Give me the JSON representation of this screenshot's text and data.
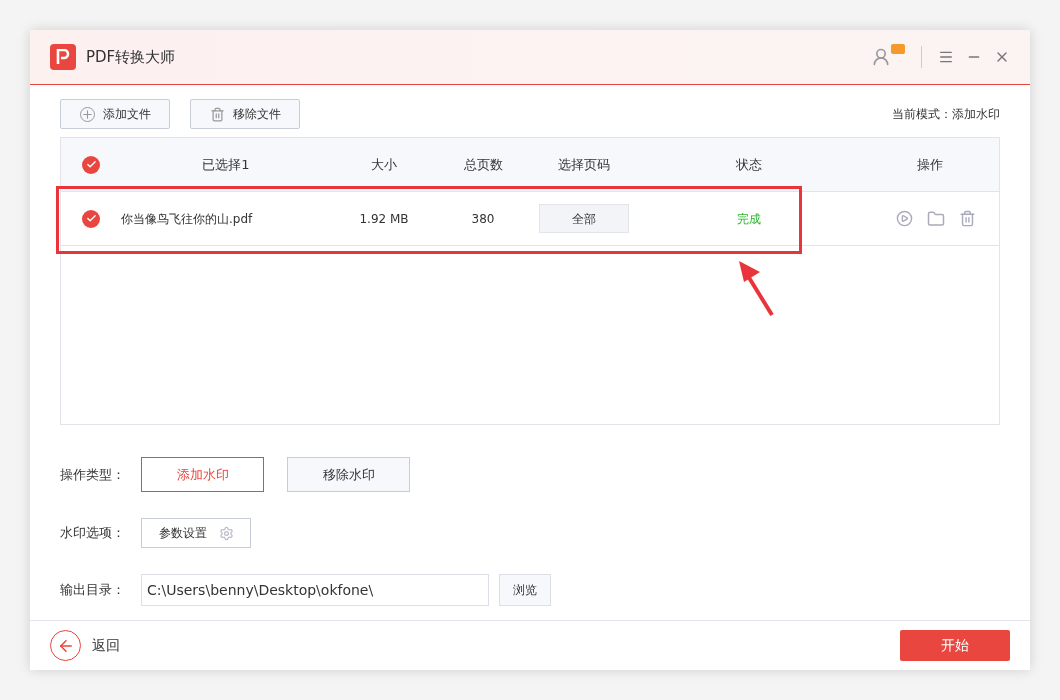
{
  "app": {
    "title": "PDF转换大师"
  },
  "toolbar": {
    "buttons": [
      {
        "label": "添加文件",
        "kind": "add"
      },
      {
        "label": "移除文件",
        "kind": "remove"
      }
    ],
    "mode_label": "当前模式：添加水印"
  },
  "table": {
    "all_checked": true,
    "columns": [
      "已选择1",
      "大小",
      "总页数",
      "选择页码",
      "状态",
      "操作"
    ],
    "rows": [
      {
        "checked": true,
        "name": "你当像鸟飞往你的山.pdf",
        "size": "1.92 MB",
        "pages": "380",
        "page_range": "全部",
        "status": "完成"
      }
    ]
  },
  "operation": {
    "label": "操作类型：",
    "options": [
      {
        "label": "添加水印",
        "selected": true
      },
      {
        "label": "移除水印",
        "selected": false
      }
    ]
  },
  "watermark": {
    "label": "水印选项：",
    "button": "参数设置"
  },
  "output": {
    "label": "输出目录：",
    "value": "C:\\Users\\benny\\Desktop\\okfone\\",
    "browse": "浏览"
  },
  "footer": {
    "back": "返回",
    "start": "开始"
  }
}
